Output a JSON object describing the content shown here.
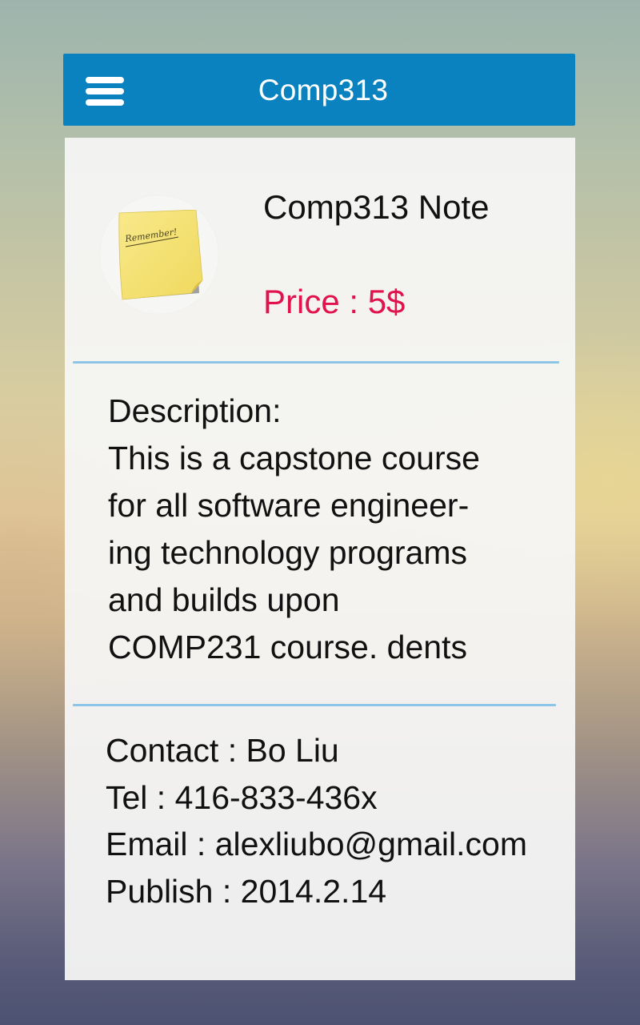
{
  "appbar": {
    "title": "Comp313",
    "menu_icon": "hamburger-menu-icon",
    "color": "#0b82c0"
  },
  "product": {
    "image_icon": "sticky-note-icon",
    "image_text": "Remember!",
    "title": "Comp313 Note",
    "price": "Price : 5$",
    "price_color": "#e0134d"
  },
  "description": {
    "lines": [
      "Description:",
      "This is a capstone course",
      "for all software engineer-",
      "ing technology programs",
      "and builds upon",
      "COMP231 course. dents"
    ]
  },
  "contact": {
    "lines": [
      "Contact : Bo Liu",
      "Tel : 416-833-436x",
      "Email : alexliubo@gmail.com",
      "Publish : 2014.2.14"
    ]
  }
}
